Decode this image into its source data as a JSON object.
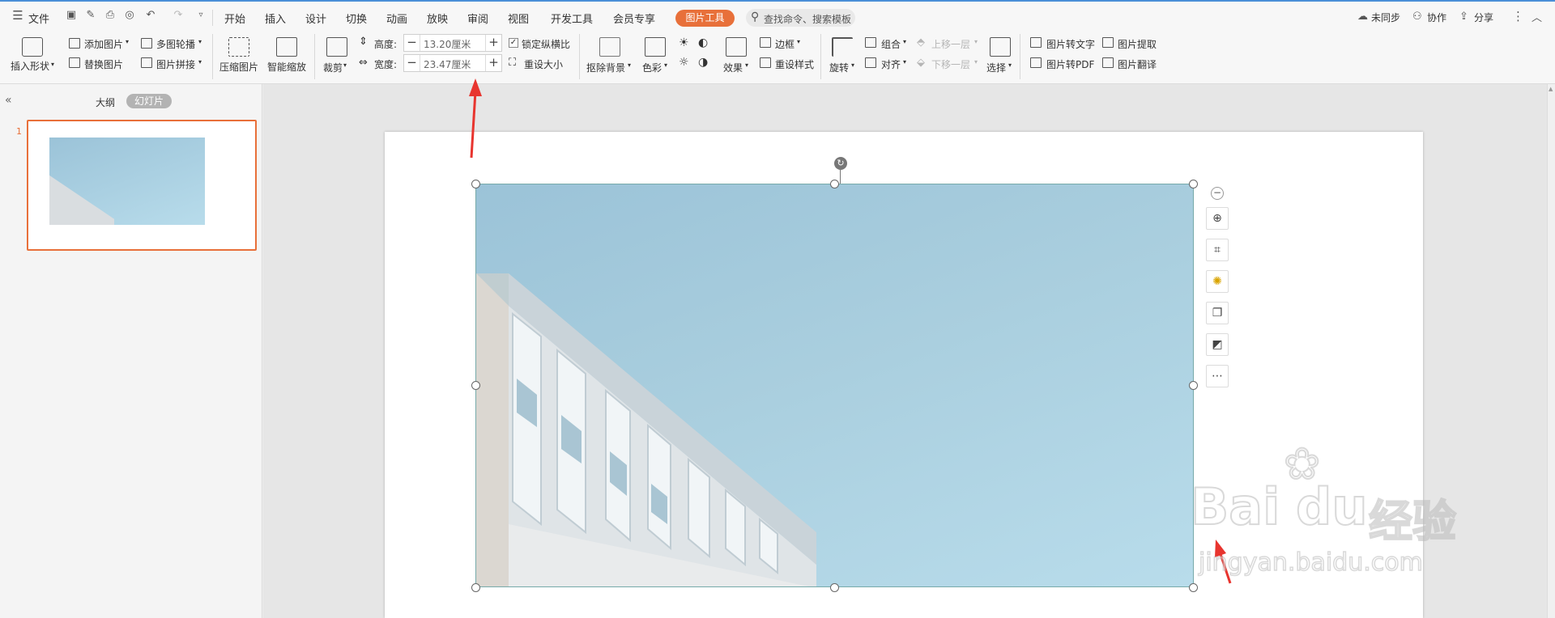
{
  "menubar": {
    "file": "文件",
    "tabs": [
      "开始",
      "插入",
      "设计",
      "切换",
      "动画",
      "放映",
      "审阅",
      "视图",
      "开发工具",
      "会员专享"
    ],
    "active_tab": "图片工具",
    "search_placeholder": "查找命令、搜索模板",
    "right": {
      "sync": "未同步",
      "collab": "协作",
      "share": "分享"
    }
  },
  "ribbon": {
    "insert_shape": "插入形状",
    "add_picture": "添加图片",
    "replace_picture": "替换图片",
    "multi_carousel": "多图轮播",
    "picture_collage": "图片拼接",
    "compress": "压缩图片",
    "smart_zoom": "智能缩放",
    "crop": "裁剪",
    "height_label": "高度:",
    "height_value": "13.20厘米",
    "width_label": "宽度:",
    "width_value": "23.47厘米",
    "lock_ratio": "锁定纵横比",
    "reset_size": "重设大小",
    "remove_bg": "抠除背景",
    "color": "色彩",
    "effects": "效果",
    "border": "边框",
    "reset_style": "重设样式",
    "rotate": "旋转",
    "group": "组合",
    "align": "对齐",
    "bring_forward": "上移一层",
    "send_backward": "下移一层",
    "select": "选择",
    "pic_to_text": "图片转文字",
    "pic_extract": "图片提取",
    "pic_to_pdf": "图片转PDF",
    "pic_translate": "图片翻译"
  },
  "panel": {
    "outline_tab": "大纲",
    "slides_tab": "幻灯片",
    "slide_number": "1"
  },
  "watermark": {
    "text1": "Bai",
    "text2": "du",
    "text3": "经验",
    "url": "jingyan.baidu.com"
  },
  "colors": {
    "accent": "#e8703a",
    "arrow": "#e8352f",
    "photo_sky": "#a9cede"
  }
}
